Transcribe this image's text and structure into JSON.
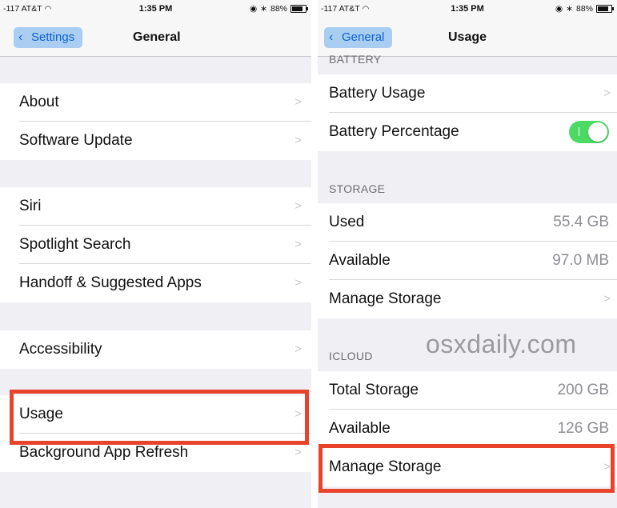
{
  "colors": {
    "background": "#efeff4",
    "back_pill": "#aacdf2",
    "link_blue": "#0a63d4",
    "toggle_on": "#4cd964",
    "highlight": "#e8442b"
  },
  "left": {
    "status": {
      "carrier": "-117 AT&T",
      "wifi_icon": "wifi-icon",
      "time": "1:35 PM",
      "battery": "88%"
    },
    "nav": {
      "back_label": "Settings",
      "title": "General"
    },
    "rows": [
      {
        "label": "About"
      },
      {
        "label": "Software Update"
      },
      {
        "label": "Siri"
      },
      {
        "label": "Spotlight Search"
      },
      {
        "label": "Handoff & Suggested Apps"
      },
      {
        "label": "Accessibility"
      },
      {
        "label": "Usage"
      },
      {
        "label": "Background App Refresh"
      }
    ],
    "chevron": ">"
  },
  "right": {
    "status": {
      "carrier": "-117 AT&T",
      "wifi_icon": "wifi-icon",
      "time": "1:35 PM",
      "battery": "88%"
    },
    "nav": {
      "back_label": "General",
      "title": "Usage"
    },
    "sections": {
      "battery": "BATTERY",
      "storage": "STORAGE",
      "icloud": "ICLOUD"
    },
    "battery_rows": [
      {
        "label": "Battery Usage"
      },
      {
        "label": "Battery Percentage",
        "toggle_on": true
      }
    ],
    "storage_rows": [
      {
        "label": "Used",
        "value": "55.4 GB"
      },
      {
        "label": "Available",
        "value": "97.0 MB"
      },
      {
        "label": "Manage Storage"
      }
    ],
    "icloud_rows": [
      {
        "label": "Total Storage",
        "value": "200 GB"
      },
      {
        "label": "Available",
        "value": "126 GB"
      },
      {
        "label": "Manage Storage"
      }
    ],
    "chevron": ">"
  },
  "watermark": "osxdaily.com"
}
